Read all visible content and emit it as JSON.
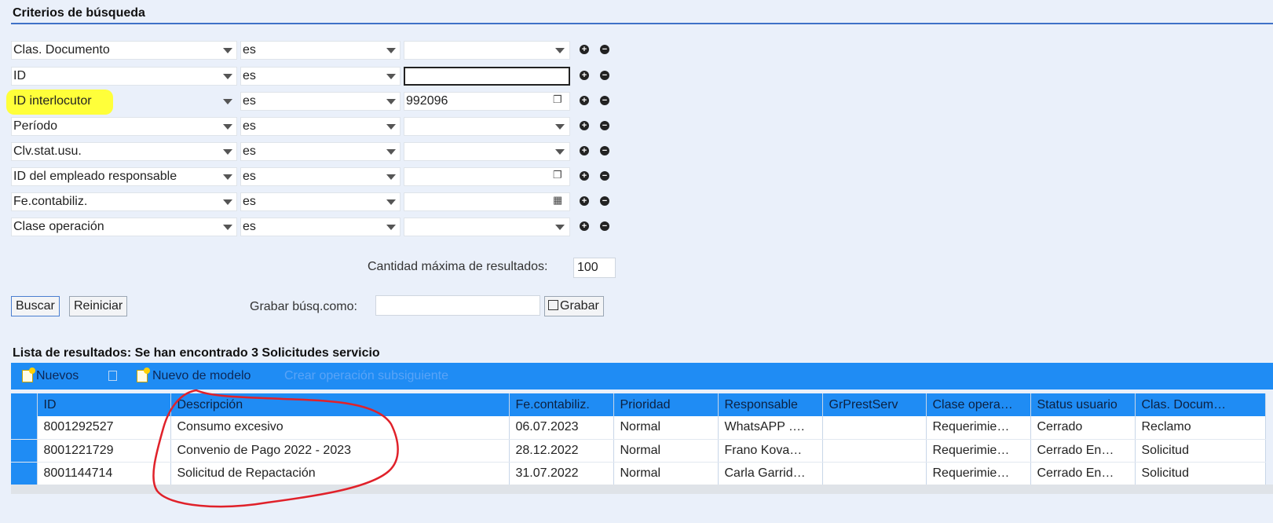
{
  "criteria": {
    "title": "Criterios de búsqueda",
    "rows": [
      {
        "field": "Clas. Documento",
        "operator": "es",
        "value": "",
        "control": "dropdown"
      },
      {
        "field": "ID",
        "operator": "es",
        "value": "",
        "control": "text-focused"
      },
      {
        "field": "ID interlocutor",
        "operator": "es",
        "value": "992096",
        "control": "search-help",
        "highlighted": true
      },
      {
        "field": "Período",
        "operator": "es",
        "value": "",
        "control": "dropdown"
      },
      {
        "field": "Clv.stat.usu.",
        "operator": "es",
        "value": "",
        "control": "dropdown"
      },
      {
        "field": "ID del empleado responsable",
        "operator": "es",
        "value": "",
        "control": "search-help"
      },
      {
        "field": "Fe.contabiliz.",
        "operator": "es",
        "value": "",
        "control": "calendar"
      },
      {
        "field": "Clase operación",
        "operator": "es",
        "value": "",
        "control": "dropdown"
      }
    ],
    "max_results_label": "Cantidad máxima de resultados:",
    "max_results_value": "100"
  },
  "actions": {
    "search_label": "Buscar",
    "reset_label": "Reiniciar",
    "save_search_label": "Grabar búsq.como:",
    "save_search_value": "",
    "save_label": "Grabar"
  },
  "results": {
    "title": "Lista de resultados: Se han encontrado 3 Solicitudes servicio",
    "toolbar": {
      "new_label": "Nuevos",
      "new_from_template_label": "Nuevo de modelo",
      "follow_up_label": "Crear operación subsiguiente"
    },
    "columns": [
      "ID",
      "Descripción",
      "Fe.contabiliz.",
      "Prioridad",
      "Responsable",
      "GrPrestServ",
      "Clase opera…",
      "Status usuario",
      "Clas. Docum…"
    ],
    "rows": [
      {
        "id": "8001292527",
        "description": "Consumo excesivo",
        "date": "06.07.2023",
        "priority": "Normal",
        "responsible": "WhatsAPP ….",
        "group": "",
        "op_class": "Requerimie…",
        "user_status": "Cerrado",
        "doc_class": "Reclamo"
      },
      {
        "id": "8001221729",
        "description": "Convenio de Pago 2022 - 2023",
        "date": "28.12.2022",
        "priority": "Normal",
        "responsible": "Frano Kova…",
        "group": "",
        "op_class": "Requerimie…",
        "user_status": "Cerrado En…",
        "doc_class": "Solicitud"
      },
      {
        "id": "8001144714",
        "description": "Solicitud de Repactación",
        "date": "31.07.2022",
        "priority": "Normal",
        "responsible": "Carla Garrid…",
        "group": "",
        "op_class": "Requerimie…",
        "user_status": "Cerrado En…",
        "doc_class": "Solicitud"
      }
    ]
  },
  "colors": {
    "accent": "#1f8cf4",
    "highlight": "#ffff3a",
    "annotation": "#e0212a",
    "link": "#2a59b5"
  }
}
